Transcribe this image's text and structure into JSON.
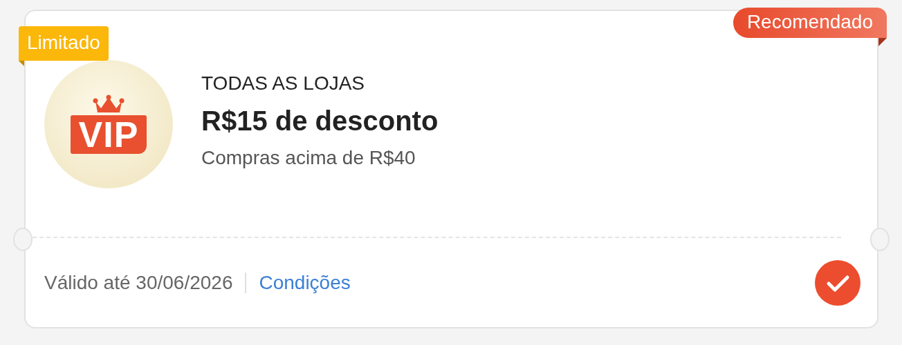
{
  "coupon": {
    "limited_badge": "Limitado",
    "recommended_badge": "Recomendado",
    "logo_text": "VIP",
    "scope": "TODAS AS LOJAS",
    "title": "R$15 de desconto",
    "condition": "Compras acima de R$40",
    "validity": "Válido até 30/06/2026",
    "terms_link": "Condições",
    "selected": true
  }
}
